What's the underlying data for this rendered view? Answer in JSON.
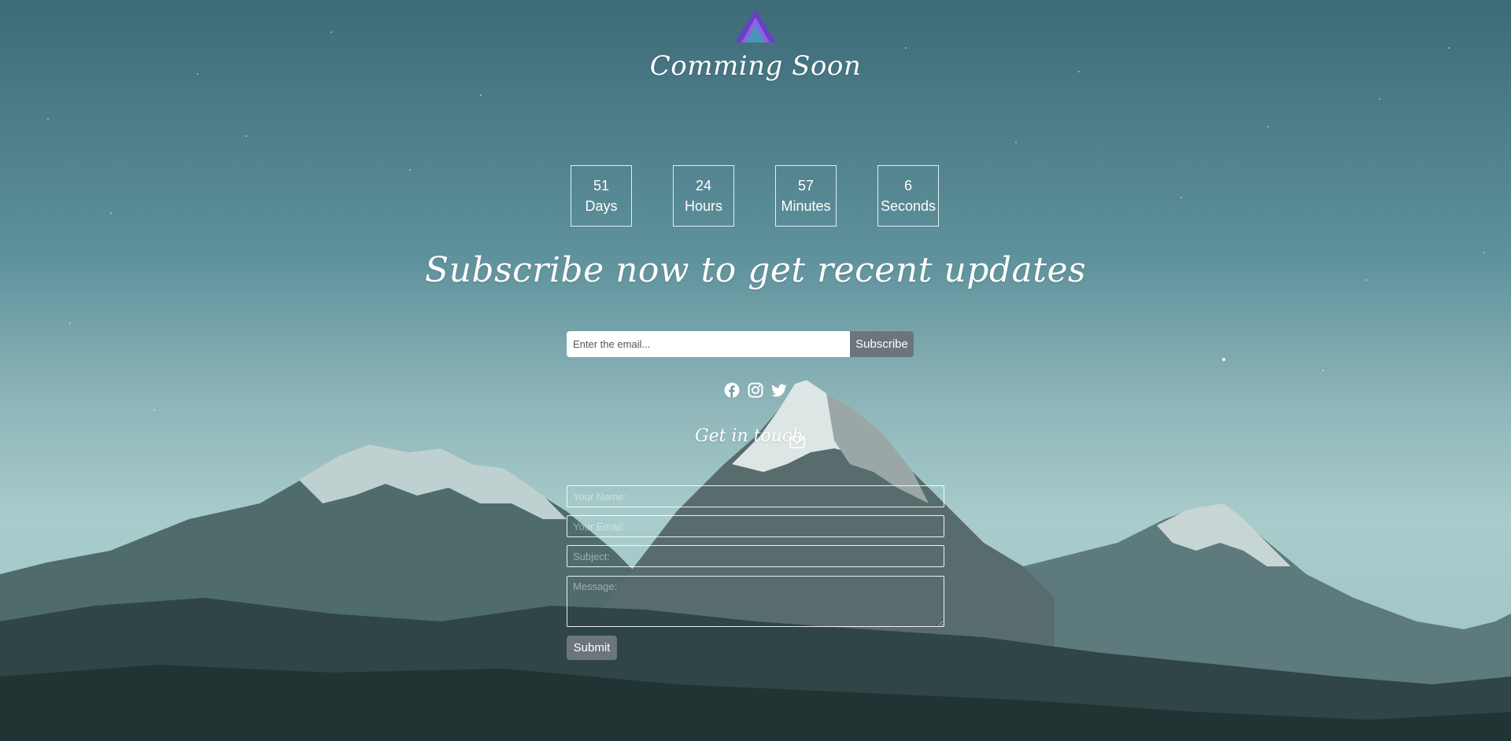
{
  "brand": {
    "logo_icon": "mountain-logo-icon",
    "title": "Comming Soon"
  },
  "countdown": [
    {
      "value": "51",
      "unit": "Days"
    },
    {
      "value": "24",
      "unit": "Hours"
    },
    {
      "value": "57",
      "unit": "Minutes"
    },
    {
      "value": "6",
      "unit": "Seconds"
    }
  ],
  "subscribe": {
    "headline": "Subscribe now to get recent updates",
    "email_placeholder": "Enter the email...",
    "button_label": "Subscribe"
  },
  "social": {
    "icons": [
      "facebook-icon",
      "instagram-icon",
      "twitter-icon"
    ]
  },
  "contact": {
    "heading": "Get in touch",
    "heading_icon": "envelope-icon",
    "name_placeholder": "Your Name:",
    "email_placeholder": "Your Email:",
    "subject_placeholder": "Subject:",
    "message_placeholder": "Message:",
    "submit_label": "Submit"
  },
  "colors": {
    "button_gray": "#6c757d",
    "logo_purple": "#7b4fd0",
    "text": "#ffffff"
  }
}
